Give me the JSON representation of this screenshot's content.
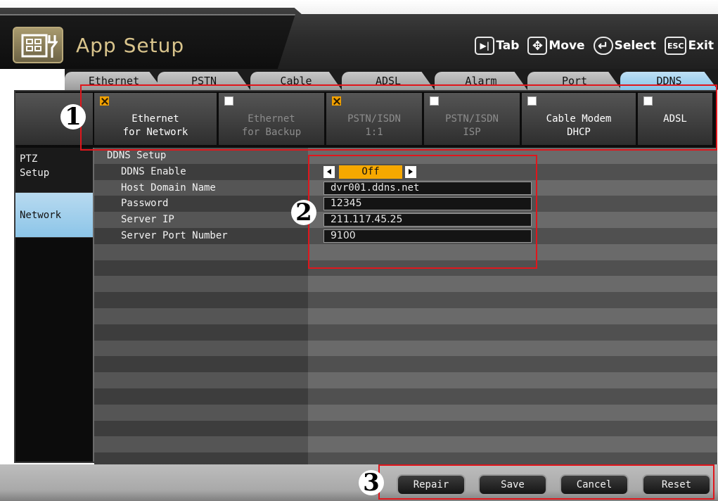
{
  "header": {
    "title": "App Setup",
    "hints": [
      {
        "key": "▶|",
        "label": "Tab",
        "icon": "tab-key-icon"
      },
      {
        "key": "✥",
        "label": "Move",
        "icon": "move-key-icon"
      },
      {
        "key": "↵",
        "label": "Select",
        "icon": "select-key-icon"
      },
      {
        "key": "ESC",
        "label": "Exit",
        "icon": "esc-key-icon"
      }
    ]
  },
  "tabs": [
    "Ethernet",
    "PSTN",
    "Cable",
    "ADSL",
    "Alarm",
    "Port",
    "DDNS"
  ],
  "active_tab": "DDNS",
  "network_options": [
    {
      "line1": "Ethernet",
      "line2": "for Network",
      "checked": true,
      "enabled": true
    },
    {
      "line1": "Ethernet",
      "line2": "for Backup",
      "checked": false,
      "enabled": false
    },
    {
      "line1": "PSTN/ISDN",
      "line2": "1:1",
      "checked": true,
      "enabled": false
    },
    {
      "line1": "PSTN/ISDN",
      "line2": "ISP",
      "checked": false,
      "enabled": false
    },
    {
      "line1": "Cable Modem",
      "line2": "DHCP",
      "checked": false,
      "enabled": true
    },
    {
      "line1": "ADSL",
      "line2": "",
      "checked": false,
      "enabled": true
    }
  ],
  "sidebar": {
    "items": [
      {
        "line1": "PTZ",
        "line2": "Setup"
      },
      {
        "line1": "Network",
        "line2": ""
      }
    ]
  },
  "ddns": {
    "section": "DDNS Setup",
    "enable_label": "DDNS Enable",
    "enable_value": "Off",
    "host_label": "Host Domain Name",
    "host_value": "dvr001.ddns.net",
    "password_label": "Password",
    "password_value": "12345",
    "server_ip_label": "Server IP",
    "server_ip_value": "211.117.45.25",
    "port_label": "Server Port Number",
    "port_value": "9100"
  },
  "buttons": {
    "repair": "Repair",
    "save": "Save",
    "cancel": "Cancel",
    "reset": "Reset"
  },
  "callouts": {
    "one": "1",
    "two": "2",
    "three": "3"
  },
  "colors": {
    "accent_orange": "#f6a800",
    "active_blue": "#8cc5e8",
    "callout_red": "#e0161c",
    "title_gold": "#d9c48c"
  }
}
